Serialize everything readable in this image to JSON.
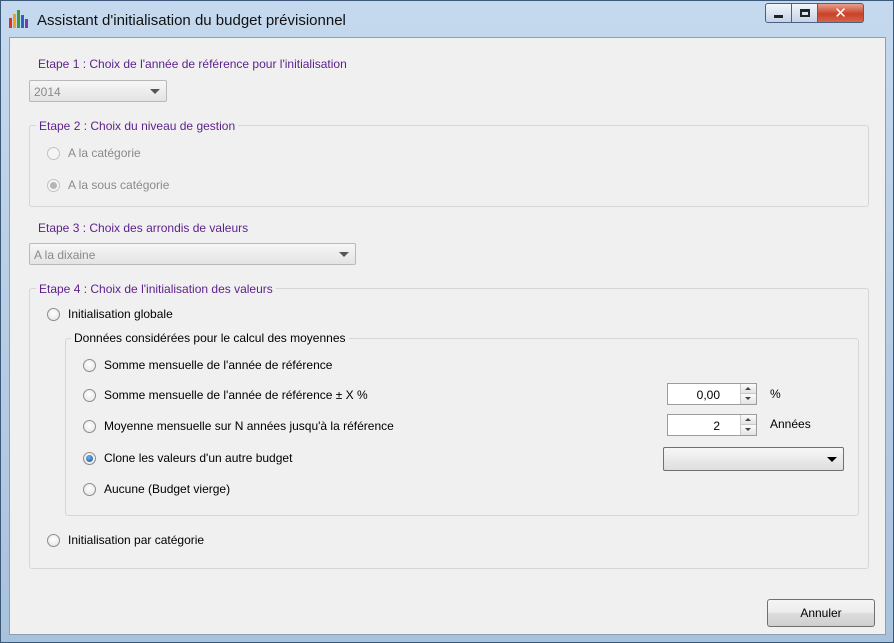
{
  "window": {
    "title": "Assistant d'initialisation du budget prévisionnel"
  },
  "step1": {
    "label": "Etape 1 : Choix de l'année de référence pour l'initialisation",
    "year": "2014"
  },
  "step2": {
    "label": "Etape 2 : Choix du niveau de gestion",
    "options": [
      {
        "label": "A la catégorie",
        "checked": false
      },
      {
        "label": "A la sous catégorie",
        "checked": true
      }
    ]
  },
  "step3": {
    "label": "Etape 3 : Choix des arrondis de valeurs",
    "rounding": "A la dixaine"
  },
  "step4": {
    "label": "Etape 4 : Choix de l'initialisation des valeurs",
    "global_label": "Initialisation globale",
    "group_label": "Données considérées pour le calcul des moyennes",
    "options": [
      {
        "label": "Somme mensuelle de l'année de référence"
      },
      {
        "label": "Somme mensuelle de l'année de référence ± X %"
      },
      {
        "label": "Moyenne mensuelle sur N années jusqu'à la référence"
      },
      {
        "label": "Clone les valeurs d'un autre budget"
      },
      {
        "label": "Aucune (Budget vierge)"
      }
    ],
    "percent_value": "0,00",
    "percent_unit": "%",
    "years_value": "2",
    "years_unit": "Années",
    "budget_select": "",
    "category_label": "Initialisation par catégorie"
  },
  "footer": {
    "cancel_label": "Annuler"
  },
  "colors": {
    "step_label": "#5c1f8c",
    "title_bar": "#c5d9ee",
    "close_button": "#c7432a"
  }
}
